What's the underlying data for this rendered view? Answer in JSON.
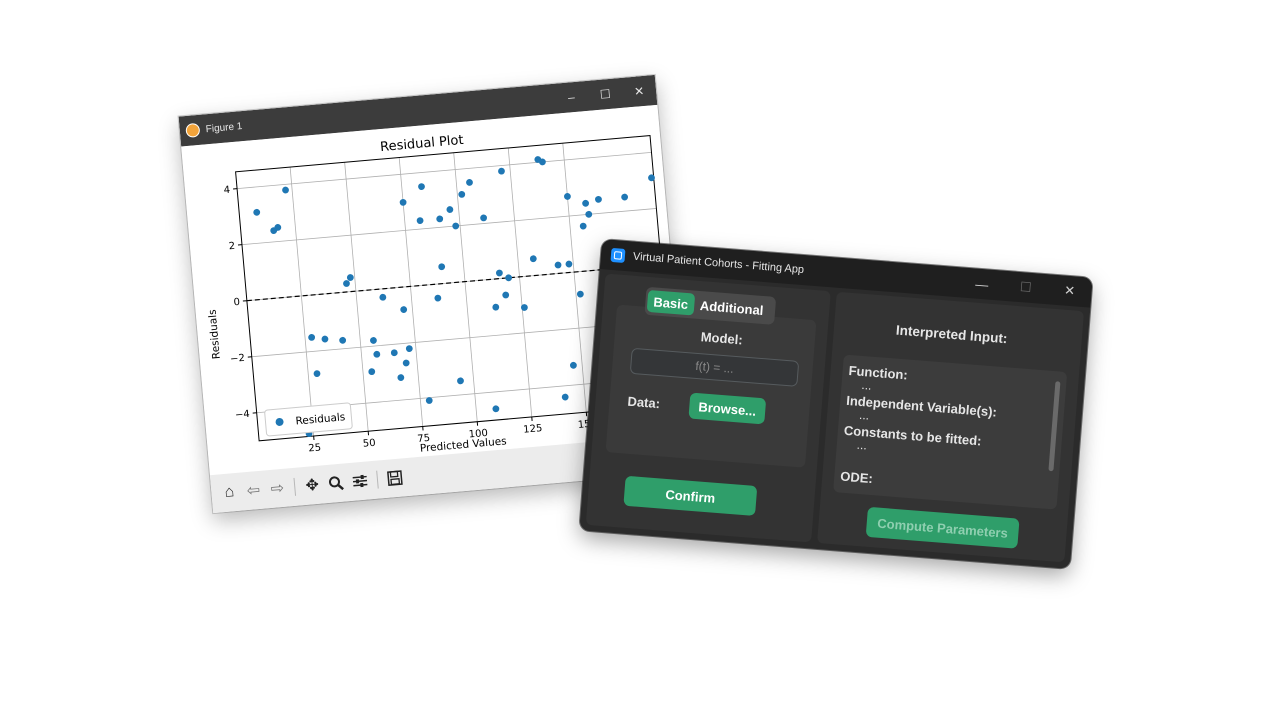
{
  "figure_window": {
    "title": "Figure 1",
    "controls": {
      "minimize": "–",
      "maximize": "☐",
      "close": "✕"
    },
    "toolbar_icons": [
      "home-icon",
      "back-arrow-icon",
      "forward-arrow-icon",
      "pan-icon",
      "zoom-icon",
      "configure-subplots-icon",
      "save-icon"
    ]
  },
  "chart_data": {
    "type": "scatter",
    "title": "Residual Plot",
    "xlabel": "Predicted Values",
    "ylabel": "Residuals",
    "xlim": [
      0,
      190
    ],
    "ylim": [
      -5,
      4.6
    ],
    "xticks": [
      25,
      50,
      75,
      100,
      125,
      150
    ],
    "yticks": [
      -4,
      -2,
      0,
      2,
      4
    ],
    "grid": true,
    "legend": "lower-left",
    "series": [
      {
        "name": "Residuals",
        "color": "#1f77b4",
        "x": [
          8,
          15,
          17,
          22,
          23,
          28,
          29,
          34,
          42,
          46,
          48,
          54,
          56,
          57,
          62,
          65,
          67,
          70,
          71,
          72,
          75,
          79,
          82,
          84,
          87,
          90,
          91,
          94,
          96,
          98,
          102,
          106,
          109,
          111,
          113,
          116,
          118,
          120,
          121,
          126,
          132,
          138,
          140,
          141,
          143,
          146,
          148,
          150,
          152,
          156,
          158,
          159,
          161,
          164,
          176,
          189
        ],
        "y": [
          3.1,
          2.4,
          2.5,
          3.8,
          -4.9,
          -1.5,
          -2.8,
          -1.6,
          -1.7,
          0.3,
          0.5,
          -2.9,
          -1.8,
          -2.3,
          -0.3,
          -2.3,
          -3.2,
          -2.7,
          -0.8,
          -2.2,
          3.0,
          -4.1,
          2.3,
          3.5,
          -0.5,
          0.6,
          2.3,
          -3.5,
          2.6,
          2.0,
          3.1,
          3.5,
          -4.6,
          2.2,
          -1.0,
          0.2,
          -0.6,
          0.0,
          3.8,
          -1.1,
          0.6,
          4.1,
          4.0,
          -4.4,
          0.3,
          -3.3,
          0.3,
          2.7,
          -0.8,
          1.6,
          2.4,
          2.0,
          -2.2,
          2.5,
          2.5,
          3.1
        ]
      }
    ],
    "reference_line": {
      "y": 0,
      "style": "dashed",
      "color": "#000000"
    }
  },
  "app_window": {
    "title": "Virtual Patient Cohorts - Fitting App",
    "controls": {
      "minimize": "—",
      "maximize": "☐",
      "close": "✕"
    },
    "tabs": [
      {
        "label": "Basic",
        "active": true
      },
      {
        "label": "Additional",
        "active": false
      }
    ],
    "model_label": "Model:",
    "model_placeholder": "f(t) = ...",
    "data_label": "Data:",
    "browse_label": "Browse...",
    "confirm_label": "Confirm",
    "interpreted_title": "Interpreted Input:",
    "function_label": "Function:",
    "function_value": "...",
    "indep_label": "Independent Variable(s):",
    "indep_value": "...",
    "constants_label": "Constants to be fitted:",
    "constants_value": "...",
    "ode_label": "ODE:",
    "compute_label": "Compute Parameters",
    "accent_color": "#2f9e6a"
  }
}
